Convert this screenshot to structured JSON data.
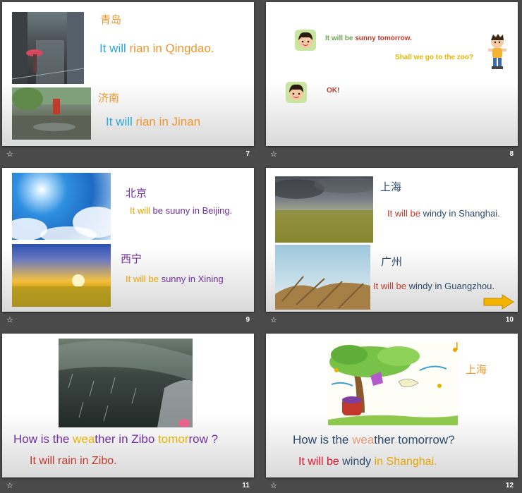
{
  "slides": [
    {
      "num": "7",
      "city1": "青岛",
      "line1a": "It will ",
      "line1b": "rian in Qingdao.",
      "city2": "济南",
      "line2a": "It will ",
      "line2b": "rian in Jinan"
    },
    {
      "num": "8",
      "girl1a": "It will be ",
      "girl1b": "sunny tomorrow.",
      "boy": "Shall we go to the zoo?",
      "girl2": "OK!"
    },
    {
      "num": "9",
      "city1": "北京",
      "l1a": "It will ",
      "l1b": "be ",
      "l1c": "suuny in Beijing.",
      "city2": "西宁",
      "l2a": "It will ",
      "l2b": "be ",
      "l2c": "sunny in Xining"
    },
    {
      "num": "10",
      "city1": "上海",
      "l1a": "It will ",
      "l1b": "be ",
      "l1c": "windy in Shanghai.",
      "city2": "广州",
      "l2a": "It will ",
      "l2b": "be ",
      "l2c": "windy in Guangzhou."
    },
    {
      "num": "11",
      "qa": "How is the ",
      "qb": "wea",
      "qc": "ther in Zibo ",
      "qd": "to",
      "qe": "mor",
      "qf": "row ?",
      "ans": "It will rain in Zibo."
    },
    {
      "num": "12",
      "city": "上海",
      "qa": "How is the ",
      "qb": "wea",
      "qc": "ther tomorrow?",
      "aa": "It will be ",
      "ab": "windy ",
      "ac": "in ",
      "ad": "Shanghai."
    }
  ],
  "colors": {
    "orange": "#f0952b",
    "blue": "#2aa6d9",
    "purple": "#7030a0",
    "red": "#c0392b",
    "dark": "#2c4a6b",
    "green": "#6aa84f",
    "yellow": "#e8b400"
  },
  "icons": {
    "nav": "slide-star-icon",
    "arrow": "next-arrow-icon"
  }
}
